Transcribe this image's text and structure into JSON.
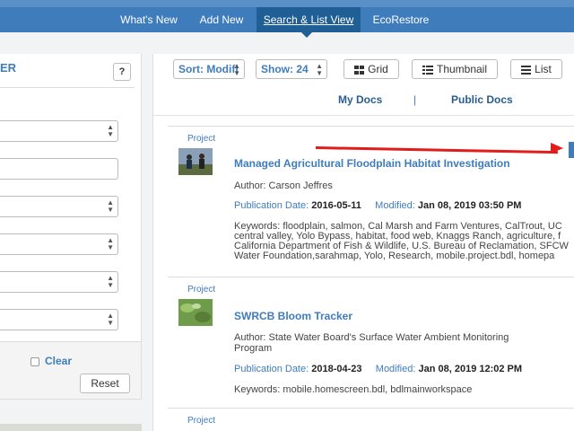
{
  "nav": {
    "items": [
      {
        "label": "What's New"
      },
      {
        "label": "Add New"
      },
      {
        "label": "Search & List View"
      },
      {
        "label": "EcoRestore"
      }
    ],
    "active_index": 2
  },
  "filter_panel": {
    "title": "ER",
    "help_label": "?",
    "clear_label": "Clear",
    "reset_label": "Reset"
  },
  "toolbar": {
    "sort_label": "Sort: Modifi",
    "show_label": "Show: 24",
    "grid_label": "Grid",
    "thumbnail_label": "Thumbnail",
    "list_label": "List"
  },
  "doc_tabs": {
    "my_docs": "My Docs",
    "divider": "|",
    "public_docs": "Public Docs"
  },
  "results": [
    {
      "type": "Project",
      "title": "Managed Agricultural Floodplain Habitat Investigation",
      "author": "Author: Carson Jeffres",
      "pub_label": "Publication Date: ",
      "pub_date": "2016-05-11",
      "mod_label": "Modified: ",
      "mod_date": "Jan 08, 2019 03:50 PM",
      "keywords": "Keywords: floodplain, salmon, Cal Marsh and Farm Ventures, CalTrout, UC central valley, Yolo Bypass, habitat, food web, Knaggs Ranch, agriculture, f California Department of Fish & Wildlife, U.S. Bureau of Reclamation, SFCW Water Foundation,sarahmap, Yolo, Research, mobile.project.bdl, homepa"
    },
    {
      "type": "Project",
      "title": "SWRCB Bloom Tracker",
      "author": "Author: State Water Board's Surface Water Ambient Monitoring Program",
      "pub_label": "Publication Date: ",
      "pub_date": "2018-04-23",
      "mod_label": "Modified: ",
      "mod_date": "Jan 08, 2019 12:02 PM",
      "keywords": "Keywords: mobile.homescreen.bdl, bdlmainworkspace"
    },
    {
      "type": "Project"
    }
  ],
  "colors": {
    "nav_bg": "#3f7cbc",
    "nav_active": "#1f5f95",
    "link": "#3f7cbc",
    "annotation_arrow": "#e21b1b"
  }
}
